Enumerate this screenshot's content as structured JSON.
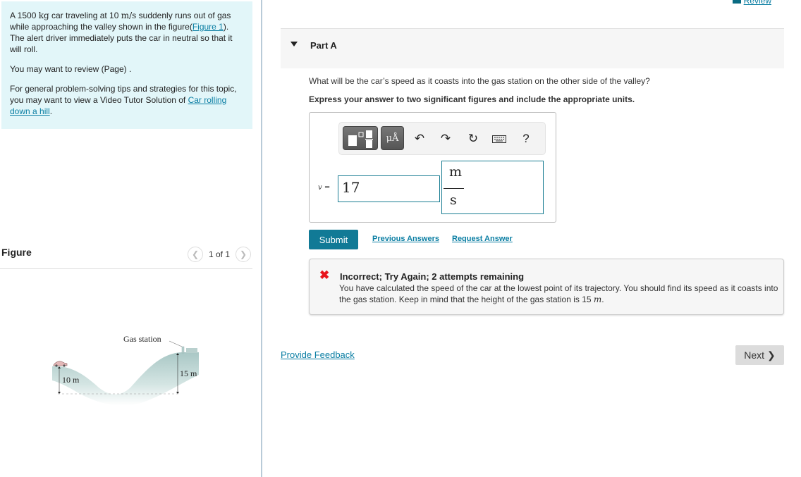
{
  "intro": {
    "p1_pre": "A 1500 ",
    "p1_mass_unit": "kg",
    "p1_mid": " car traveling at 10 ",
    "p1_speed_unit": "m/s",
    "p1_mid2": " suddenly runs out of gas while approaching the valley shown in the figure(",
    "figure_link": "Figure 1",
    "p1_post": "). The alert driver immediately puts the car in neutral so that it will roll.",
    "p2": "You may want to review (Page) .",
    "p3_pre": "For general problem-solving tips and strategies for this topic, you may want to view a Video Tutor Solution of ",
    "p3_link": "Car rolling down a hill",
    "p3_post": "."
  },
  "figure": {
    "title": "Figure",
    "counter": "1 of 1",
    "prev_icon": "chevron-left-icon",
    "next_icon": "chevron-right-icon",
    "labels": {
      "gas_station": "Gas station",
      "left_height": "10 m",
      "right_height": "15 m"
    }
  },
  "header": {
    "review_label": "Review",
    "review_icon": "book-icon"
  },
  "part": {
    "title": "Part A",
    "question": "What will be the car’s speed as it coasts into the gas station on the other side of the valley?",
    "instruction": "Express your answer to two significant figures and include the appropriate units."
  },
  "answer": {
    "toolbar": {
      "templates_icon": "templates-icon",
      "units_label": "μÅ",
      "undo_icon": "undo-icon",
      "redo_icon": "redo-icon",
      "reset_icon": "reset-icon",
      "keyboard_icon": "keyboard-icon",
      "help_label": "?"
    },
    "variable": "v =",
    "value": "17",
    "unit_numerator": "m",
    "unit_denominator": "s"
  },
  "actions": {
    "submit": "Submit",
    "previous_answers": "Previous Answers",
    "request_answer": "Request Answer"
  },
  "feedback": {
    "status": "Incorrect; Try Again; 2 attempts remaining",
    "message_pre": "You have calculated the speed of the car at the lowest point of its trajectory. You should find its speed as it coasts into the gas station. Keep in mind that the height of the gas station is 15 ",
    "message_unit": "m",
    "message_post": ".",
    "status_color": "#e8141c"
  },
  "footer": {
    "provide_feedback": "Provide Feedback",
    "next": "Next"
  }
}
